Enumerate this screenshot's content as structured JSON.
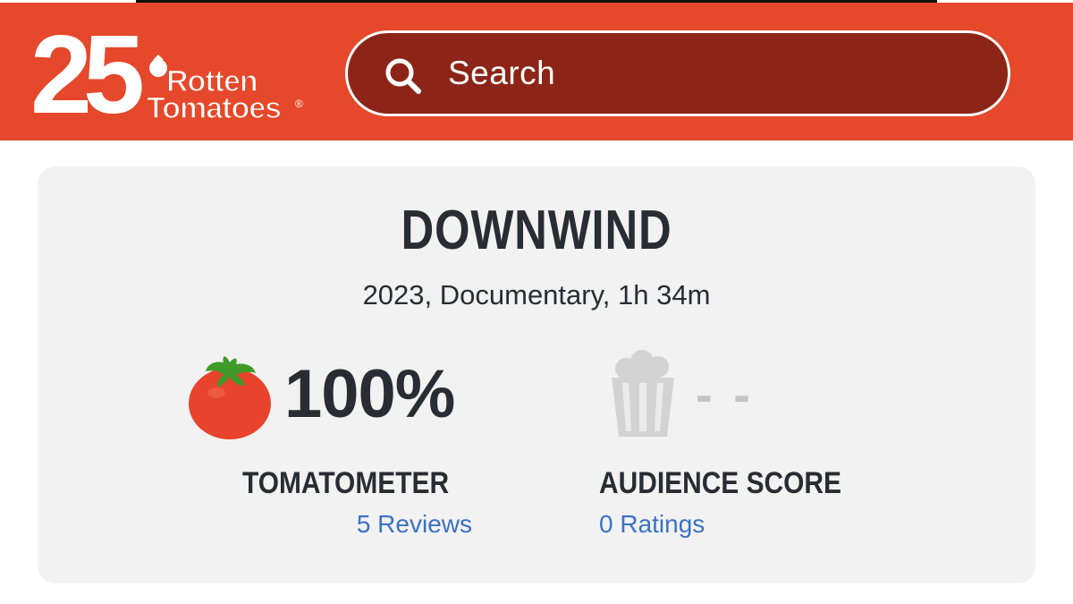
{
  "header": {
    "logo": {
      "anniversary_number": "25",
      "brand_line1": "Rotten",
      "brand_line2": "Tomatoes",
      "registered_mark": "®"
    },
    "search": {
      "placeholder": "Search",
      "icon": "search-icon"
    }
  },
  "movie": {
    "title": "DOWNWIND",
    "meta": "2023, Documentary, 1h 34m"
  },
  "scores": {
    "tomatometer": {
      "icon": "fresh-tomato-icon",
      "value": "100%",
      "label": "TOMATOMETER",
      "count_text": "5 Reviews"
    },
    "audience": {
      "icon": "empty-popcorn-icon",
      "value": "- -",
      "label": "AUDIENCE SCORE",
      "count_text": "0 Ratings"
    }
  },
  "colors": {
    "header_red": "#e5482a",
    "search_bg": "#8c2518",
    "card_bg": "#f2f2f2",
    "text_dark": "#2a2c33",
    "link_blue": "#3a72c4",
    "muted_gray": "#c4c4c4",
    "tomato_red": "#e8432c",
    "tomato_leaf": "#3f9a2a"
  }
}
